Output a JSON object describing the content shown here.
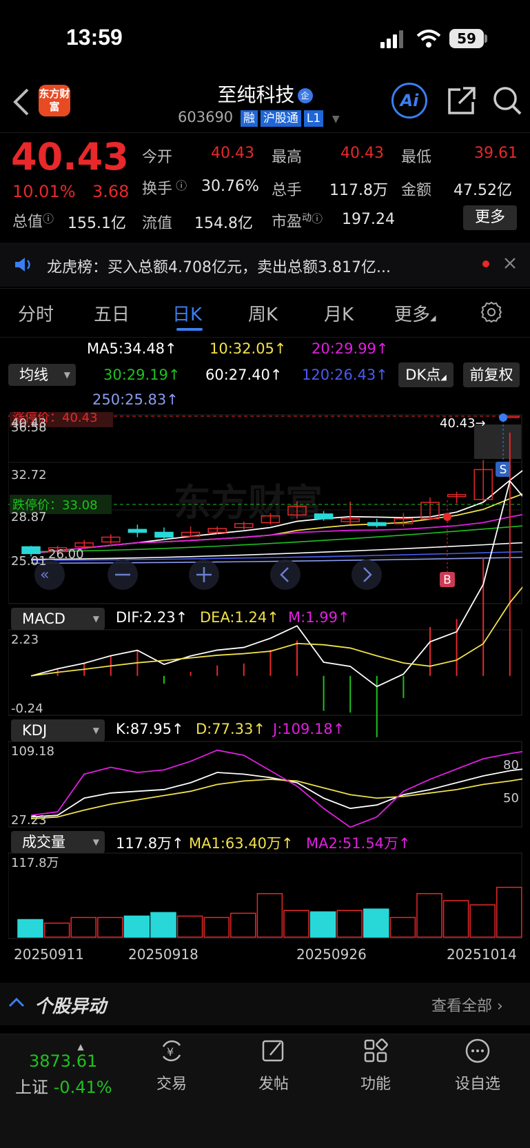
{
  "status": {
    "time": "13:59",
    "battery": "59"
  },
  "header": {
    "title": "至纯科技",
    "badge_qiye": "企",
    "code": "603690",
    "tags": [
      "融",
      "沪股通",
      "L1"
    ],
    "ai_label": "Ai",
    "logo_text": "东方财富"
  },
  "quote": {
    "price": "40.43",
    "pct": "10.01%",
    "change": "3.68",
    "fields": [
      {
        "label": "今开",
        "value": "40.43",
        "color": "red"
      },
      {
        "label": "最高",
        "value": "40.43",
        "color": "red"
      },
      {
        "label": "最低",
        "value": "39.61",
        "color": "red"
      },
      {
        "label": "换手",
        "value": "30.76%",
        "color": "white"
      },
      {
        "label": "总手",
        "value": "117.8万",
        "color": "white"
      },
      {
        "label": "金额",
        "value": "47.52亿",
        "color": "white"
      },
      {
        "label": "总值",
        "value": "155.1亿",
        "color": "white"
      },
      {
        "label": "流值",
        "value": "154.8亿",
        "color": "white"
      },
      {
        "label": "市盈",
        "sup": "动",
        "value": "197.24",
        "color": "white"
      }
    ],
    "more_label": "更多"
  },
  "notice": {
    "text": "龙虎榜：买入总额4.708亿元，卖出总额3.817亿..."
  },
  "tabs": [
    "分时",
    "五日",
    "日K",
    "周K",
    "月K",
    "更多"
  ],
  "active_tab": "日K",
  "ma": {
    "select": "均线",
    "items": [
      "MA5:34.48↑",
      "10:32.05↑",
      "20:29.99↑",
      "30:29.19↑",
      "60:27.40↑",
      "120:26.43↑",
      "250:25.83↑"
    ],
    "colors": [
      "#ffffff",
      "#f2e24a",
      "#e020e0",
      "#1fc21f",
      "#ffffff",
      "#4a5cf0",
      "#8a9cf0"
    ],
    "dk_label": "DK点",
    "fq_label": "前复权"
  },
  "kline": {
    "limit_up_label": "涨停价：40.43",
    "limit_down_label": "跌停价：33.08",
    "y_labels": [
      "40.43",
      "36.58",
      "32.72",
      "28.87",
      "25.01"
    ],
    "latest_label": "40.43→",
    "nav_low": "26.00",
    "s_mark": "S",
    "b_mark": "B"
  },
  "macd": {
    "select": "MACD",
    "items": [
      "DIF:2.23↑",
      "DEA:1.24↑",
      "M:1.99↑"
    ],
    "y_top": "2.23",
    "y_bottom": "-0.24"
  },
  "kdj": {
    "select": "KDJ",
    "items": [
      "K:87.95↑",
      "D:77.33↑",
      "J:109.18↑"
    ],
    "y_top": "109.18",
    "y_bottom": "27.23",
    "r80": "80",
    "r50": "50"
  },
  "vol": {
    "select": "成交量",
    "items": [
      "117.8万↑",
      "MA1:63.40万↑",
      "MA2:51.54万↑"
    ],
    "y_top": "117.8万"
  },
  "dates": [
    "20250911",
    "20250918",
    "20250926",
    "20251014"
  ],
  "section": {
    "title": "个股异动",
    "link": "查看全部"
  },
  "bottom": {
    "index_value": "3873.61",
    "index_name": "上证",
    "index_pct": "-0.41%",
    "items": [
      {
        "label": "交易",
        "icon": "yuan-exchange-icon"
      },
      {
        "label": "发帖",
        "icon": "edit-icon"
      },
      {
        "label": "功能",
        "icon": "grid-icon"
      },
      {
        "label": "设自选",
        "icon": "more-circle-icon"
      }
    ]
  },
  "chart_data": {
    "type": "candlestick",
    "categories": [
      "20250911",
      "",
      "",
      "",
      "",
      "",
      "20250918",
      "",
      "",
      "",
      "",
      "",
      "20250926",
      "",
      "",
      "",
      "",
      "",
      "",
      "20251014"
    ],
    "candles": [
      {
        "o": 26.9,
        "c": 26.2,
        "h": 27.0,
        "l": 25.9,
        "up": true
      },
      {
        "o": 26.4,
        "c": 26.8,
        "h": 27.0,
        "l": 26.2,
        "up": true
      },
      {
        "o": 26.9,
        "c": 27.3,
        "h": 27.6,
        "l": 26.8,
        "up": true
      },
      {
        "o": 27.4,
        "c": 27.9,
        "h": 28.2,
        "l": 27.2,
        "up": true
      },
      {
        "o": 28.7,
        "c": 28.4,
        "h": 29.2,
        "l": 27.9,
        "up": false
      },
      {
        "o": 28.4,
        "c": 27.9,
        "h": 28.9,
        "l": 27.6,
        "up": false
      },
      {
        "o": 28.0,
        "c": 28.4,
        "h": 29.0,
        "l": 27.9,
        "up": true
      },
      {
        "o": 28.4,
        "c": 28.8,
        "h": 29.0,
        "l": 28.2,
        "up": true
      },
      {
        "o": 28.9,
        "c": 29.3,
        "h": 29.5,
        "l": 28.7,
        "up": true
      },
      {
        "o": 29.4,
        "c": 30.1,
        "h": 30.4,
        "l": 29.2,
        "up": true
      },
      {
        "o": 30.2,
        "c": 31.1,
        "h": 31.6,
        "l": 29.8,
        "up": true
      },
      {
        "o": 30.3,
        "c": 29.8,
        "h": 30.6,
        "l": 29.6,
        "up": false
      },
      {
        "o": 29.5,
        "c": 29.8,
        "h": 31.6,
        "l": 29.2,
        "up": true
      },
      {
        "o": 29.4,
        "c": 29.1,
        "h": 29.8,
        "l": 28.9,
        "up": false
      },
      {
        "o": 29.3,
        "c": 29.8,
        "h": 30.4,
        "l": 29.0,
        "up": true
      },
      {
        "o": 29.8,
        "c": 31.5,
        "h": 32.0,
        "l": 29.7,
        "up": true
      },
      {
        "o": 32.1,
        "c": 32.3,
        "h": 32.6,
        "l": 31.4,
        "up": true
      },
      {
        "o": 31.8,
        "c": 34.9,
        "h": 35.9,
        "l": 31.6,
        "up": true
      },
      {
        "o": 40.43,
        "c": 40.43,
        "h": 40.43,
        "l": 40.43,
        "up": true
      },
      {
        "o": 39.61,
        "c": 40.43,
        "h": 40.43,
        "l": 39.61,
        "up": true
      }
    ],
    "ylim": [
      25.01,
      40.43
    ]
  }
}
